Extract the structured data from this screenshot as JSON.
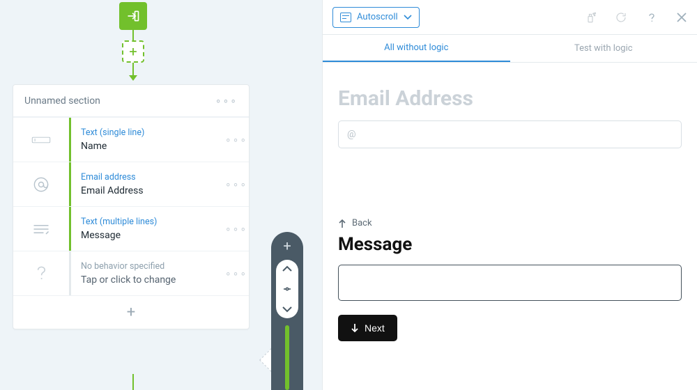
{
  "canvas": {
    "section_title": "Unnamed section",
    "fields": [
      {
        "type": "Text (single line)",
        "name": "Name"
      },
      {
        "type": "Email address",
        "name": "Email Address"
      },
      {
        "type": "Text (multiple lines)",
        "name": "Message"
      },
      {
        "type": "No behavior specified",
        "name": "Tap or click to change"
      }
    ],
    "add_plus": "+"
  },
  "rail": {
    "plus": "+"
  },
  "preview": {
    "autoscroll_label": "Autoscroll",
    "tabs": {
      "all": "All without logic",
      "test": "Test with logic"
    },
    "ghost_heading": "Email Address",
    "ghost_placeholder": "@",
    "back_label": "Back",
    "message_heading": "Message",
    "next_label": "Next"
  }
}
